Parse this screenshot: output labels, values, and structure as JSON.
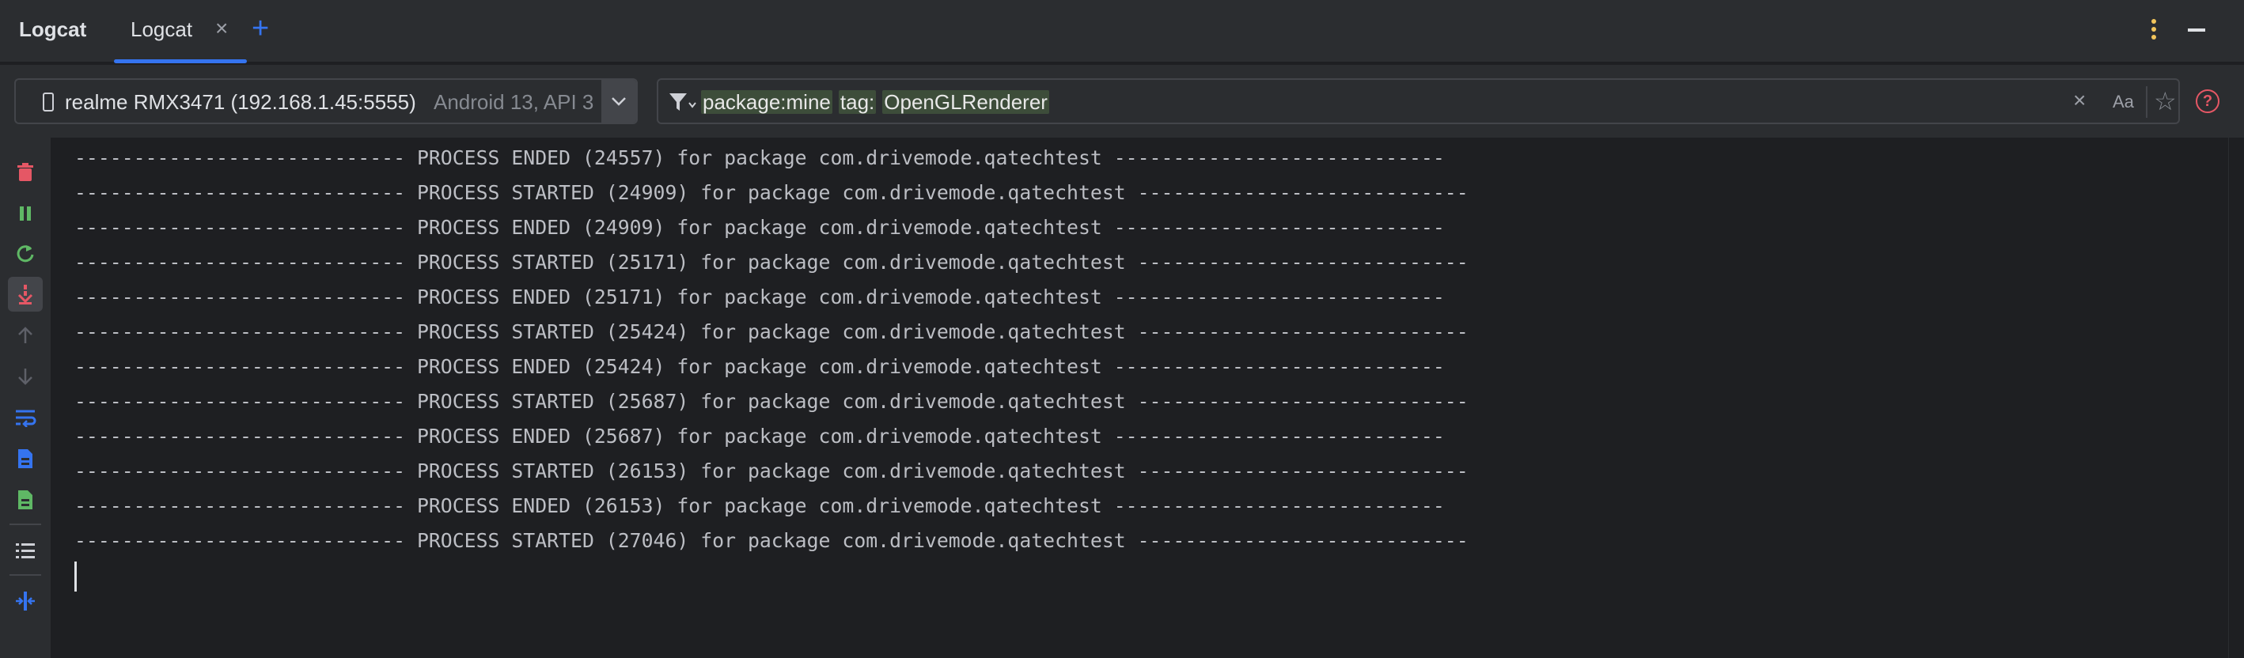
{
  "topbar": {
    "tool_title": "Logcat",
    "tabs": [
      {
        "label": "Logcat",
        "active": true
      }
    ],
    "add_tab_label": "+"
  },
  "device": {
    "name": "realme RMX3471 (192.168.1.45:5555)",
    "extra": "Android 13, API 3"
  },
  "filter": {
    "query_parts": [
      "package:mine",
      "tag:",
      "OpenGLRenderer"
    ],
    "match_case_label": "Aa"
  },
  "sidebar": {
    "items": [
      {
        "name": "clear-logcat-icon",
        "color": "#e55765"
      },
      {
        "name": "pause-icon",
        "color": "#5fb865"
      },
      {
        "name": "restart-icon",
        "color": "#5fb865"
      },
      {
        "name": "scroll-to-end-icon",
        "color": "#e55765"
      },
      {
        "name": "previous-occurrence-icon",
        "color": "#5e6068"
      },
      {
        "name": "next-occurrence-icon",
        "color": "#5e6068"
      },
      {
        "name": "soft-wrap-icon",
        "color": "#3574f0"
      },
      {
        "name": "export-logs-icon",
        "color": "#3574f0"
      },
      {
        "name": "import-logs-icon",
        "color": "#5fb865"
      },
      {
        "name": "view-format-icon",
        "color": "#ced0d6"
      },
      {
        "name": "split-panels-icon",
        "color": "#3574f0"
      }
    ]
  },
  "log": {
    "lines": [
      "---------------------------- PROCESS ENDED (24557) for package com.drivemode.qatechtest ----------------------------",
      "---------------------------- PROCESS STARTED (24909) for package com.drivemode.qatechtest ----------------------------",
      "---------------------------- PROCESS ENDED (24909) for package com.drivemode.qatechtest ----------------------------",
      "---------------------------- PROCESS STARTED (25171) for package com.drivemode.qatechtest ----------------------------",
      "---------------------------- PROCESS ENDED (25171) for package com.drivemode.qatechtest ----------------------------",
      "---------------------------- PROCESS STARTED (25424) for package com.drivemode.qatechtest ----------------------------",
      "---------------------------- PROCESS ENDED (25424) for package com.drivemode.qatechtest ----------------------------",
      "---------------------------- PROCESS STARTED (25687) for package com.drivemode.qatechtest ----------------------------",
      "---------------------------- PROCESS ENDED (25687) for package com.drivemode.qatechtest ----------------------------",
      "---------------------------- PROCESS STARTED (26153) for package com.drivemode.qatechtest ----------------------------",
      "---------------------------- PROCESS ENDED (26153) for package com.drivemode.qatechtest ----------------------------",
      "---------------------------- PROCESS STARTED (27046) for package com.drivemode.qatechtest ----------------------------"
    ]
  }
}
